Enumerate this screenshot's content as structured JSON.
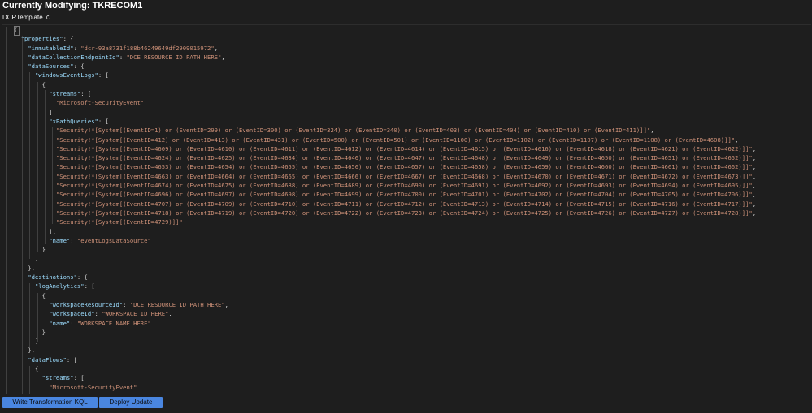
{
  "header": {
    "title": "Currently Modifying: TKRECOM1",
    "template_name": "DCRTemplate",
    "refresh_icon": "refresh-icon"
  },
  "footer": {
    "write_kql_label": "Write Transformation KQL",
    "deploy_label": "Deploy Update"
  },
  "editor": {
    "lines": [
      [
        [
          "pun",
          "{"
        ]
      ],
      [
        [
          "pun",
          "  "
        ],
        [
          "key",
          "\"properties\""
        ],
        [
          "pun",
          ": {"
        ]
      ],
      [
        [
          "pun",
          "    "
        ],
        [
          "key",
          "\"immutableId\""
        ],
        [
          "pun",
          ": "
        ],
        [
          "str",
          "\"dcr-93a8731f188b46249649df2909015972\""
        ],
        [
          "pun",
          ","
        ]
      ],
      [
        [
          "pun",
          "    "
        ],
        [
          "key",
          "\"dataCollectionEndpointId\""
        ],
        [
          "pun",
          ": "
        ],
        [
          "str",
          "\"DCE RESOURCE ID PATH HERE\""
        ],
        [
          "pun",
          ","
        ]
      ],
      [
        [
          "pun",
          "    "
        ],
        [
          "key",
          "\"dataSources\""
        ],
        [
          "pun",
          ": {"
        ]
      ],
      [
        [
          "pun",
          "      "
        ],
        [
          "key",
          "\"windowsEventLogs\""
        ],
        [
          "pun",
          ": ["
        ]
      ],
      [
        [
          "pun",
          "        {"
        ]
      ],
      [
        [
          "pun",
          "          "
        ],
        [
          "key",
          "\"streams\""
        ],
        [
          "pun",
          ": ["
        ]
      ],
      [
        [
          "pun",
          "            "
        ],
        [
          "str",
          "\"Microsoft-SecurityEvent\""
        ]
      ],
      [
        [
          "pun",
          "          ],"
        ]
      ],
      [
        [
          "pun",
          "          "
        ],
        [
          "key",
          "\"xPathQueries\""
        ],
        [
          "pun",
          ": ["
        ]
      ],
      [
        [
          "pun",
          "            "
        ],
        [
          "str",
          "\"Security!*[System[(EventID=1) or (EventID=299) or (EventID=300) or (EventID=324) or (EventID=340) or (EventID=403) or (EventID=404) or (EventID=410) or (EventID=411)]]\""
        ],
        [
          "pun",
          ","
        ]
      ],
      [
        [
          "pun",
          "            "
        ],
        [
          "str",
          "\"Security!*[System[(EventID=412) or (EventID=413) or (EventID=431) or (EventID=500) or (EventID=501) or (EventID=1100) or (EventID=1102) or (EventID=1107) or (EventID=1108) or (EventID=4608)]]\""
        ],
        [
          "pun",
          ","
        ]
      ],
      [
        [
          "pun",
          "            "
        ],
        [
          "str",
          "\"Security!*[System[(EventID=4609) or (EventID=4610) or (EventID=4611) or (EventID=4612) or (EventID=4614) or (EventID=4615) or (EventID=4616) or (EventID=4618) or (EventID=4621) or (EventID=4622)]]\""
        ],
        [
          "pun",
          ","
        ]
      ],
      [
        [
          "pun",
          "            "
        ],
        [
          "str",
          "\"Security!*[System[(EventID=4624) or (EventID=4625) or (EventID=4634) or (EventID=4646) or (EventID=4647) or (EventID=4648) or (EventID=4649) or (EventID=4650) or (EventID=4651) or (EventID=4652)]]\""
        ],
        [
          "pun",
          ","
        ]
      ],
      [
        [
          "pun",
          "            "
        ],
        [
          "str",
          "\"Security!*[System[(EventID=4653) or (EventID=4654) or (EventID=4655) or (EventID=4656) or (EventID=4657) or (EventID=4658) or (EventID=4659) or (EventID=4660) or (EventID=4661) or (EventID=4662)]]\""
        ],
        [
          "pun",
          ","
        ]
      ],
      [
        [
          "pun",
          "            "
        ],
        [
          "str",
          "\"Security!*[System[(EventID=4663) or (EventID=4664) or (EventID=4665) or (EventID=4666) or (EventID=4667) or (EventID=4668) or (EventID=4670) or (EventID=4671) or (EventID=4672) or (EventID=4673)]]\""
        ],
        [
          "pun",
          ","
        ]
      ],
      [
        [
          "pun",
          "            "
        ],
        [
          "str",
          "\"Security!*[System[(EventID=4674) or (EventID=4675) or (EventID=4688) or (EventID=4689) or (EventID=4690) or (EventID=4691) or (EventID=4692) or (EventID=4693) or (EventID=4694) or (EventID=4695)]]\""
        ],
        [
          "pun",
          ","
        ]
      ],
      [
        [
          "pun",
          "            "
        ],
        [
          "str",
          "\"Security!*[System[(EventID=4696) or (EventID=4697) or (EventID=4698) or (EventID=4699) or (EventID=4700) or (EventID=4701) or (EventID=4702) or (EventID=4704) or (EventID=4705) or (EventID=4706)]]\""
        ],
        [
          "pun",
          ","
        ]
      ],
      [
        [
          "pun",
          "            "
        ],
        [
          "str",
          "\"Security!*[System[(EventID=4707) or (EventID=4709) or (EventID=4710) or (EventID=4711) or (EventID=4712) or (EventID=4713) or (EventID=4714) or (EventID=4715) or (EventID=4716) or (EventID=4717)]]\""
        ],
        [
          "pun",
          ","
        ]
      ],
      [
        [
          "pun",
          "            "
        ],
        [
          "str",
          "\"Security!*[System[(EventID=4718) or (EventID=4719) or (EventID=4720) or (EventID=4722) or (EventID=4723) or (EventID=4724) or (EventID=4725) or (EventID=4726) or (EventID=4727) or (EventID=4728)]]\""
        ],
        [
          "pun",
          ","
        ]
      ],
      [
        [
          "pun",
          "            "
        ],
        [
          "str",
          "\"Security!*[System[(EventID=4729)]]\""
        ]
      ],
      [
        [
          "pun",
          "          ],"
        ]
      ],
      [
        [
          "pun",
          "          "
        ],
        [
          "key",
          "\"name\""
        ],
        [
          "pun",
          ": "
        ],
        [
          "str",
          "\"eventLogsDataSource\""
        ]
      ],
      [
        [
          "pun",
          "        }"
        ]
      ],
      [
        [
          "pun",
          "      ]"
        ]
      ],
      [
        [
          "pun",
          "    },"
        ]
      ],
      [
        [
          "pun",
          "    "
        ],
        [
          "key",
          "\"destinations\""
        ],
        [
          "pun",
          ": {"
        ]
      ],
      [
        [
          "pun",
          "      "
        ],
        [
          "key",
          "\"logAnalytics\""
        ],
        [
          "pun",
          ": ["
        ]
      ],
      [
        [
          "pun",
          "        {"
        ]
      ],
      [
        [
          "pun",
          "          "
        ],
        [
          "key",
          "\"workspaceResourceId\""
        ],
        [
          "pun",
          ": "
        ],
        [
          "str",
          "\"DCE RESOURCE ID PATH HERE\""
        ],
        [
          "pun",
          ","
        ]
      ],
      [
        [
          "pun",
          "          "
        ],
        [
          "key",
          "\"workspaceId\""
        ],
        [
          "pun",
          ": "
        ],
        [
          "str",
          "\"WORKSPACE ID HERE\""
        ],
        [
          "pun",
          ","
        ]
      ],
      [
        [
          "pun",
          "          "
        ],
        [
          "key",
          "\"name\""
        ],
        [
          "pun",
          ": "
        ],
        [
          "str",
          "\"WORKSPACE NAME HERE\""
        ]
      ],
      [
        [
          "pun",
          "        }"
        ]
      ],
      [
        [
          "pun",
          "      ]"
        ]
      ],
      [
        [
          "pun",
          "    },"
        ]
      ],
      [
        [
          "pun",
          "    "
        ],
        [
          "key",
          "\"dataFlows\""
        ],
        [
          "pun",
          ": ["
        ]
      ],
      [
        [
          "pun",
          "      {"
        ]
      ],
      [
        [
          "pun",
          "        "
        ],
        [
          "key",
          "\"streams\""
        ],
        [
          "pun",
          ": ["
        ]
      ],
      [
        [
          "pun",
          "          "
        ],
        [
          "str",
          "\"Microsoft-SecurityEvent\""
        ]
      ]
    ],
    "colors": {
      "key": "#9cdcfe",
      "string": "#ce9178",
      "punctuation": "#d4d4d4",
      "background": "#1e1e1e",
      "button": "#4a86e0"
    }
  }
}
